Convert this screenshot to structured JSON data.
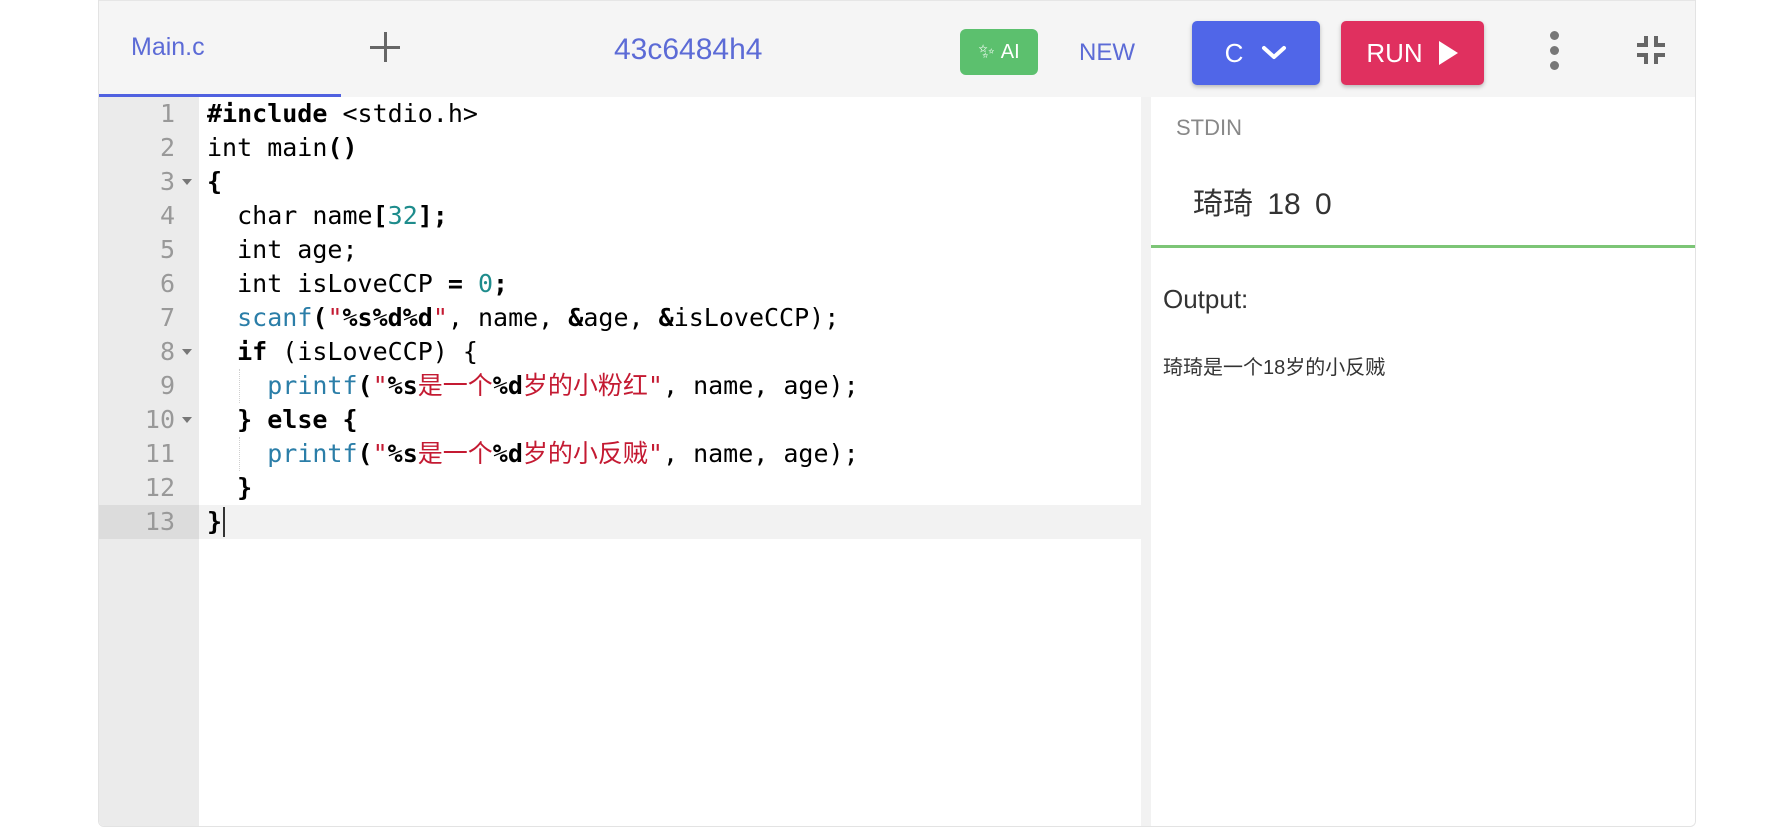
{
  "toolbar": {
    "file_tab": "Main.c",
    "file_id": "43c6484h4",
    "ai_label": "AI",
    "new_label": "NEW",
    "language": "C",
    "run_label": "RUN"
  },
  "editor": {
    "lines": [
      {
        "n": "1",
        "fold": false
      },
      {
        "n": "2",
        "fold": false
      },
      {
        "n": "3",
        "fold": true
      },
      {
        "n": "4",
        "fold": false
      },
      {
        "n": "5",
        "fold": false
      },
      {
        "n": "6",
        "fold": false
      },
      {
        "n": "7",
        "fold": false
      },
      {
        "n": "8",
        "fold": true
      },
      {
        "n": "9",
        "fold": false
      },
      {
        "n": "10",
        "fold": true
      },
      {
        "n": "11",
        "fold": false
      },
      {
        "n": "12",
        "fold": false
      },
      {
        "n": "13",
        "fold": false
      }
    ],
    "code": {
      "l1": {
        "a": "#include",
        "b": " <stdio.h>"
      },
      "l2": {
        "a": "int main",
        "b": "()"
      },
      "l3": {
        "a": "{"
      },
      "l4": {
        "a": "  char name",
        "b": "[",
        "c": "32",
        "d": "];"
      },
      "l5": {
        "a": "  int age;"
      },
      "l6": {
        "a": "  int isLoveCCP ",
        "b": "=",
        "c": " ",
        "d": "0",
        "e": ";"
      },
      "l7": {
        "a": "  ",
        "fn": "scanf",
        "p1": "(",
        "q1": "\"",
        "fmt": "%s%d%d",
        "q2": "\"",
        "rest": ", name, ",
        "amp1": "&",
        "r2": "age, ",
        "amp2": "&",
        "r3": "isLoveCCP);"
      },
      "l8": {
        "a": "  ",
        "kw": "if",
        "b": " (isLoveCCP) {"
      },
      "l9": {
        "a": "    ",
        "fn": "printf",
        "p1": "(",
        "q1": "\"",
        "f1": "%s",
        "s1": "是一个",
        "f2": "%d",
        "s2": "岁的小粉红",
        "q2": "\"",
        "rest": ", name, age);"
      },
      "l10": {
        "a": "  } ",
        "kw": "else",
        "b": " {"
      },
      "l11": {
        "a": "    ",
        "fn": "printf",
        "p1": "(",
        "q1": "\"",
        "f1": "%s",
        "s1": "是一个",
        "f2": "%d",
        "s2": "岁的小反贼",
        "q2": "\"",
        "rest": ", name, age);"
      },
      "l12": {
        "a": "  }"
      },
      "l13": {
        "a": "}"
      }
    }
  },
  "stdin": {
    "label": "STDIN",
    "value": "琦琦  18  0"
  },
  "output": {
    "label": "Output:",
    "text": "琦琦是一个18岁的小反贼"
  },
  "colors": {
    "accent": "#5066e8",
    "run": "#e0305f",
    "ai": "#5cc06e",
    "stdin_border": "#7cc576"
  },
  "icons": {
    "add_tab": "plus-icon",
    "ai": "sparkle-icon",
    "language": "chevron-down-icon",
    "run": "play-icon",
    "more": "kebab-menu-icon",
    "collapse": "collapse-icon"
  }
}
